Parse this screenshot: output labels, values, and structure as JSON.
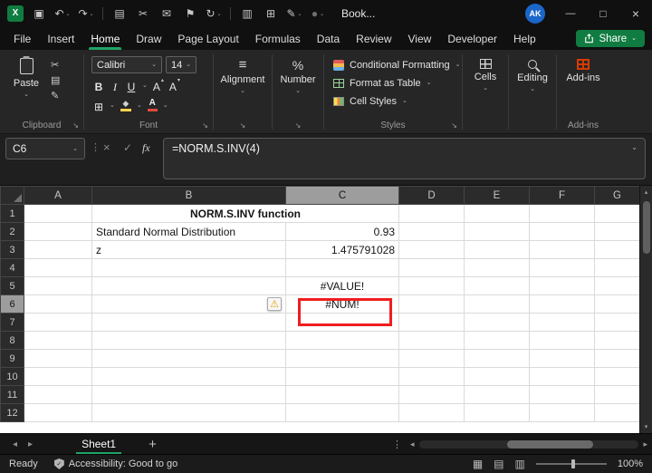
{
  "titlebar": {
    "title": "Book...",
    "avatar": "AK",
    "qat": [
      {
        "name": "excel-logo",
        "glyph": "X",
        "logo": true
      },
      {
        "name": "save-icon",
        "glyph": "▣"
      },
      {
        "name": "undo-icon",
        "glyph": "↶",
        "dropdown": true
      },
      {
        "name": "redo-icon",
        "glyph": "↷",
        "dropdown": true
      },
      {
        "divider": true
      },
      {
        "name": "copy-icon",
        "glyph": "▤"
      },
      {
        "name": "cut-icon",
        "glyph": "✂"
      },
      {
        "name": "mail-icon",
        "glyph": "✉"
      },
      {
        "name": "flag-icon",
        "glyph": "⚑"
      },
      {
        "name": "refresh-icon",
        "glyph": "↻",
        "dropdown": true
      },
      {
        "divider": true
      },
      {
        "name": "workbook-icon",
        "glyph": "▥"
      },
      {
        "name": "table-icon",
        "glyph": "⊞"
      },
      {
        "name": "pen-icon",
        "glyph": "✎",
        "dropdown": true
      },
      {
        "name": "record-icon",
        "glyph": "●",
        "dim": true,
        "dropdown": true
      }
    ],
    "window_controls": {
      "minimize": "—",
      "maximize": "□",
      "close": "×"
    }
  },
  "menubar": {
    "items": [
      "File",
      "Insert",
      "Home",
      "Draw",
      "Page Layout",
      "Formulas",
      "Data",
      "Review",
      "View",
      "Developer",
      "Help"
    ],
    "active": "Home",
    "share": {
      "label": "Share"
    }
  },
  "ribbon": {
    "clipboard": {
      "paste": "Paste",
      "label": "Clipboard",
      "icons": {
        "cut": "✂",
        "copy": "▤",
        "painter": "✎"
      }
    },
    "font": {
      "name": "Calibri",
      "size": "14",
      "bold": "B",
      "italic": "I",
      "underline": "U",
      "grow": "A",
      "shrink": "A",
      "color_letter": "A",
      "borders_glyph": "⊞",
      "fill_glyph": "◆",
      "label": "Font"
    },
    "alignment": {
      "label": "Alignment",
      "glyph": "≡"
    },
    "number": {
      "label": "Number",
      "glyph": "%"
    },
    "styles": {
      "items": [
        "Conditional Formatting",
        "Format as Table",
        "Cell Styles"
      ],
      "label": "Styles"
    },
    "cells": {
      "label": "Cells"
    },
    "editing": {
      "label": "Editing"
    },
    "addins": {
      "label": "Add-ins",
      "group_label": "Add-ins"
    }
  },
  "formula_bar": {
    "name_box": "C6",
    "cancel": "×",
    "enter": "✓",
    "fx": "fx",
    "formula": "=NORM.S.INV(4)"
  },
  "grid": {
    "columns": [
      "A",
      "B",
      "C",
      "D",
      "E",
      "F",
      "G"
    ],
    "row_count": 12,
    "selected_column": "C",
    "selected_row": "6",
    "warning_glyph": "⚠",
    "cells": [
      {
        "ref": "B1",
        "col": "B",
        "row": 1,
        "text": "NORM.S.INV function",
        "cls": "title-cell",
        "colspan": 2,
        "align": "center"
      },
      {
        "ref": "B2",
        "col": "B",
        "row": 2,
        "text": "Standard Normal Distribution",
        "cls": "green-cell",
        "align": "left"
      },
      {
        "ref": "C2",
        "col": "C",
        "row": 2,
        "text": "0.93",
        "cls": "green-cell",
        "align": "right"
      },
      {
        "ref": "B3",
        "col": "B",
        "row": 3,
        "text": "z",
        "cls": "green-cell",
        "align": "left"
      },
      {
        "ref": "C3",
        "col": "C",
        "row": 3,
        "text": "1.475791028",
        "cls": "green-cell",
        "align": "right"
      },
      {
        "ref": "C5",
        "col": "C",
        "row": 5,
        "text": "#VALUE!",
        "cls": "lightgreen-cell",
        "align": "center"
      },
      {
        "ref": "B6",
        "col": "B",
        "row": 6,
        "icon": "error-warning-icon",
        "align": "right"
      },
      {
        "ref": "C6",
        "col": "C",
        "row": 6,
        "text": "#NUM!",
        "cls": "lightgreen-cell selected-cell",
        "align": "center"
      }
    ]
  },
  "sheet_tabs": {
    "prev": "◂",
    "next": "▸",
    "active": "Sheet1",
    "add": "+",
    "menu": "⋮",
    "hprev": "◂",
    "hnext": "▸"
  },
  "status_bar": {
    "mode": "Ready",
    "accessibility": "Accessibility: Good to go",
    "accessibility_check": "✓",
    "views": [
      {
        "name": "normal-view-icon",
        "glyph": "▦"
      },
      {
        "name": "page-layout-view-icon",
        "glyph": "▤"
      },
      {
        "name": "page-break-view-icon",
        "glyph": "▥"
      }
    ],
    "zoom": "100%"
  },
  "ui": {
    "chevron": "⌄",
    "launcher": "↘",
    "up_tri": "▴",
    "down_tri": "▾",
    "dots": "⋮"
  },
  "colors": {
    "accent_green": "#107C41",
    "tab_underline": "#21A366",
    "title_fill": "#ED7D31",
    "title_text": "#7E3100",
    "green_fill": "#C6E0B4",
    "green_border": "#70AD47",
    "lightgreen_fill": "#E2EFDA",
    "lightgreen_border": "#548235",
    "annotation_red": "#F01E1E",
    "avatar_blue": "#1B66C9",
    "warning_yellow": "#E8A000"
  }
}
